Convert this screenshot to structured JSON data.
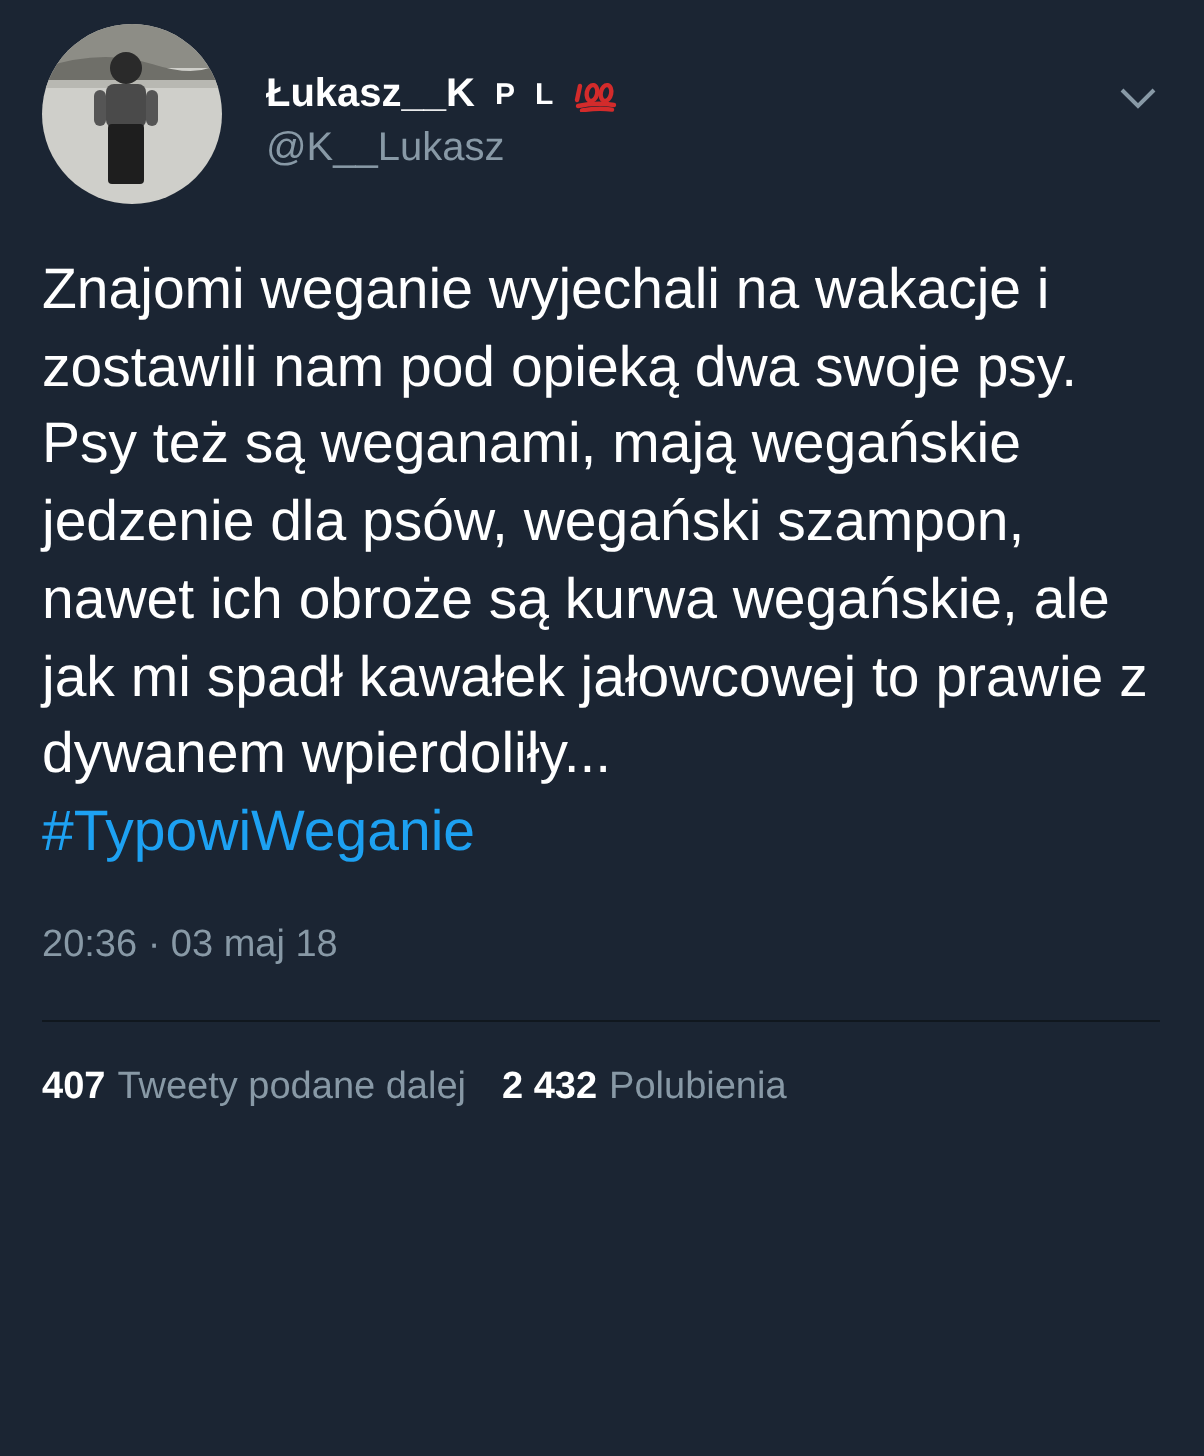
{
  "tweet": {
    "author": {
      "name": "Łukasz__K",
      "badges": [
        "P",
        "L"
      ],
      "handle": "@K__Lukasz"
    },
    "paragraphs": [
      "Znajomi weganie wyjechali na wakacje i zostawili nam pod opieką dwa swoje psy.",
      "Psy też są weganami, mają wegańskie jedzenie dla psów, wegański szampon, nawet ich obroże są kurwa wegańskie, ale jak mi spadł kawałek jałowcowej to prawie z dywanem wpierdoliły..."
    ],
    "hashtag": "#TypowiWeganie",
    "timestamp": "20:36 · 03 maj 18",
    "stats": [
      {
        "count": "407",
        "label": "Tweety podane dalej"
      },
      {
        "count": "2 432",
        "label": "Polubienia"
      }
    ]
  }
}
